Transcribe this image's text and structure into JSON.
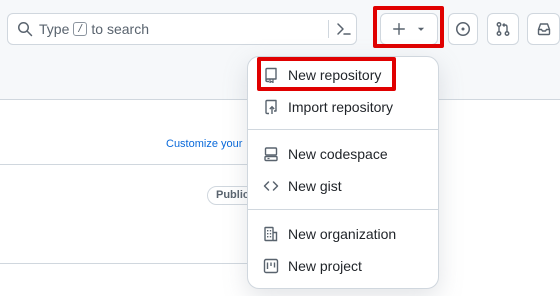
{
  "header": {
    "search": {
      "prefix": "Type",
      "key": "/",
      "suffix": "to search"
    },
    "icons": {
      "search": "search-icon",
      "command": "command-palette-icon",
      "create": "plus-icon",
      "caret": "triangle-down-icon",
      "issues": "issue-opened-icon",
      "pulls": "git-pull-request-icon",
      "inbox": "inbox-icon"
    }
  },
  "background": {
    "customize_text": "Customize your",
    "public_badge": "Public"
  },
  "create_menu": {
    "items": [
      {
        "label": "New repository",
        "icon": "repo-icon"
      },
      {
        "label": "Import repository",
        "icon": "repo-push-icon"
      },
      {
        "label": "New codespace",
        "icon": "codespaces-icon"
      },
      {
        "label": "New gist",
        "icon": "code-icon"
      },
      {
        "label": "New organization",
        "icon": "organization-icon"
      },
      {
        "label": "New project",
        "icon": "project-icon"
      }
    ]
  },
  "colors": {
    "highlight": "#e00000",
    "link": "#0969da",
    "border": "#d0d7de",
    "header_bg": "#f6f8fa"
  }
}
